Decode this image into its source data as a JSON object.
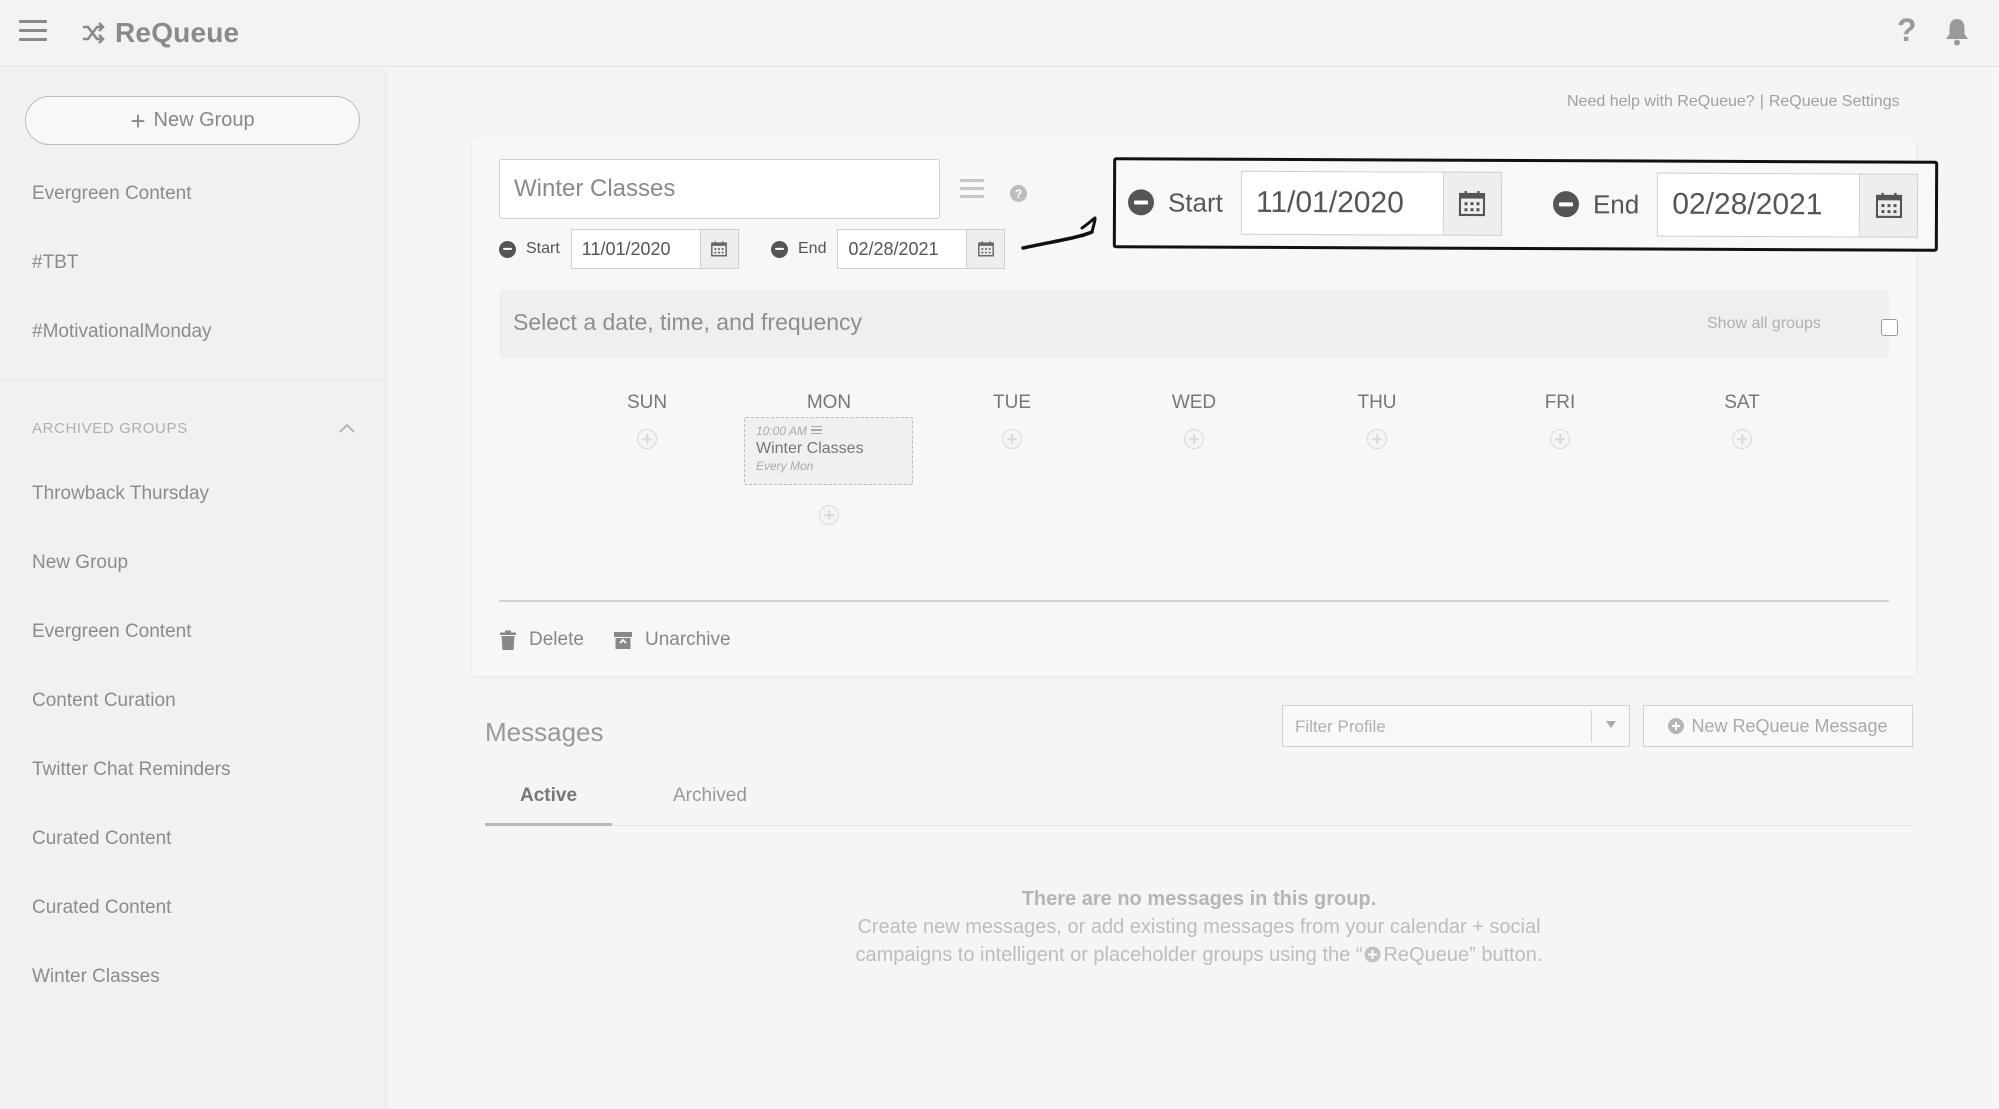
{
  "app": {
    "name": "ReQueue"
  },
  "sidebar": {
    "new_group_label": "New Group",
    "groups": [
      "Evergreen Content",
      "#TBT",
      "#MotivationalMonday"
    ],
    "archived_header": "ARCHIVED GROUPS",
    "archived_groups": [
      "Throwback Thursday",
      "New Group",
      "Evergreen Content",
      "Content Curation",
      "Twitter Chat Reminders",
      "Curated Content",
      "Curated Content",
      "Winter Classes"
    ]
  },
  "header_links": {
    "help": "Need help with ReQueue?",
    "separator": "|",
    "settings": "ReQueue Settings"
  },
  "group_editor": {
    "name_value": "Winter Classes",
    "start_label": "Start",
    "start_date": "11/01/2020",
    "end_label": "End",
    "end_date": "02/28/2021",
    "frequency_prompt": "Select a date, time, and frequency",
    "show_all_groups_label": "Show all groups",
    "days": [
      "SUN",
      "MON",
      "TUE",
      "WED",
      "THU",
      "FRI",
      "SAT"
    ],
    "event": {
      "day": "MON",
      "time": "10:00 AM",
      "title": "Winter Classes",
      "frequency": "Every Mon"
    },
    "delete_label": "Delete",
    "unarchive_label": "Unarchive"
  },
  "callout": {
    "start_label": "Start",
    "start_date": "11/01/2020",
    "end_label": "End",
    "end_date": "02/28/2021"
  },
  "messages": {
    "title": "Messages",
    "filter_placeholder": "Filter Profile",
    "new_message_label": "New ReQueue Message",
    "tabs": [
      "Active",
      "Archived"
    ],
    "active_tab": "Active",
    "empty_title": "There are no messages in this group.",
    "empty_text_before": "Create new messages, or add existing messages from your calendar + social campaigns to intelligent or placeholder groups using the “",
    "empty_text_button": "ReQueue",
    "empty_text_after": "” button."
  },
  "colors": {
    "background": "#f5f5f5",
    "sidebar": "#f1f1f1",
    "text": "#666666",
    "callout_border": "#111111"
  },
  "icons": [
    "menu-icon",
    "shuffle-icon",
    "help-icon",
    "bell-icon",
    "plus-icon",
    "menu-lines-icon",
    "question-icon",
    "minus-circle-icon",
    "calendar-icon",
    "plus-circle-icon",
    "trash-icon",
    "archive-box-icon",
    "chevron-up-icon",
    "caret-down-icon",
    "arrow-icon"
  ]
}
